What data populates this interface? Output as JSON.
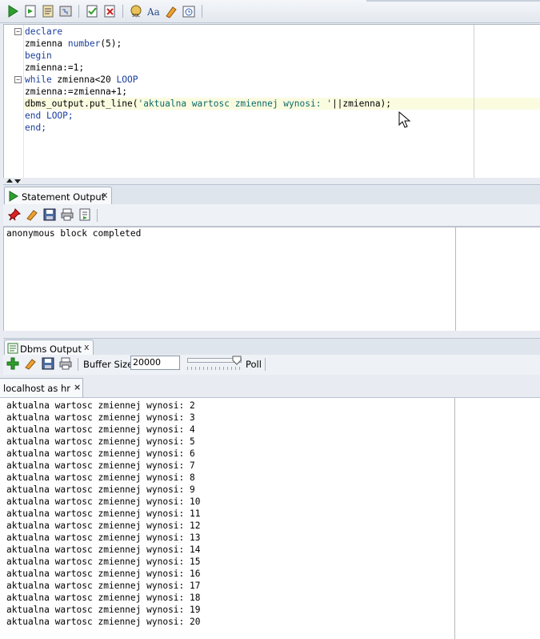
{
  "toolbar": {
    "icons": [
      "run-icon",
      "run-script-icon",
      "autotrace-icon",
      "explain-plan-icon",
      "commit-icon",
      "rollback-icon",
      "sql-tuning-icon",
      "format-icon",
      "clear-icon",
      "history-icon"
    ]
  },
  "editor": {
    "lines": [
      [
        {
          "t": "declare",
          "c": "kw"
        }
      ],
      [
        {
          "t": "zmienna ",
          "c": ""
        },
        {
          "t": "number",
          "c": "kw"
        },
        {
          "t": "(5);",
          "c": ""
        }
      ],
      [
        {
          "t": "begin",
          "c": "kw"
        }
      ],
      [
        {
          "t": "zmienna:=1;",
          "c": ""
        }
      ],
      [
        {
          "t": "while",
          "c": "kw"
        },
        {
          "t": " zmienna<20 ",
          "c": ""
        },
        {
          "t": "LOOP",
          "c": "kw"
        }
      ],
      [
        {
          "t": "zmienna:=zmienna+1;",
          "c": ""
        }
      ],
      [
        {
          "t": "dbms_output.put_line(",
          "c": ""
        },
        {
          "t": "'aktualna wartosc zmiennej wynosi: '",
          "c": "str"
        },
        {
          "t": "||zmienna);",
          "c": ""
        }
      ],
      [
        {
          "t": "end ",
          "c": "kw"
        },
        {
          "t": "LOOP;",
          "c": "kw"
        }
      ],
      [
        {
          "t": "end;",
          "c": "kw"
        }
      ]
    ]
  },
  "statement_output": {
    "tab_label": "Statement Output",
    "close": "x",
    "text": "anonymous block completed"
  },
  "dbms_output": {
    "tab_label": "Dbms Output",
    "close": "x",
    "buffer_label": "Buffer Size:",
    "buffer_value": "20000",
    "poll_label": "Poll",
    "connection_tab": "localhost as hr",
    "connection_close": "×",
    "lines": [
      "aktualna wartosc zmiennej wynosi: 2",
      "aktualna wartosc zmiennej wynosi: 3",
      "aktualna wartosc zmiennej wynosi: 4",
      "aktualna wartosc zmiennej wynosi: 5",
      "aktualna wartosc zmiennej wynosi: 6",
      "aktualna wartosc zmiennej wynosi: 7",
      "aktualna wartosc zmiennej wynosi: 8",
      "aktualna wartosc zmiennej wynosi: 9",
      "aktualna wartosc zmiennej wynosi: 10",
      "aktualna wartosc zmiennej wynosi: 11",
      "aktualna wartosc zmiennej wynosi: 12",
      "aktualna wartosc zmiennej wynosi: 13",
      "aktualna wartosc zmiennej wynosi: 14",
      "aktualna wartosc zmiennej wynosi: 15",
      "aktualna wartosc zmiennej wynosi: 16",
      "aktualna wartosc zmiennej wynosi: 17",
      "aktualna wartosc zmiennej wynosi: 18",
      "aktualna wartosc zmiennej wynosi: 19",
      "aktualna wartosc zmiennej wynosi: 20"
    ]
  },
  "colors": {
    "keyword": "#1a3e9e",
    "string": "#0a6a6a",
    "current_line": "#fbfbe0"
  }
}
